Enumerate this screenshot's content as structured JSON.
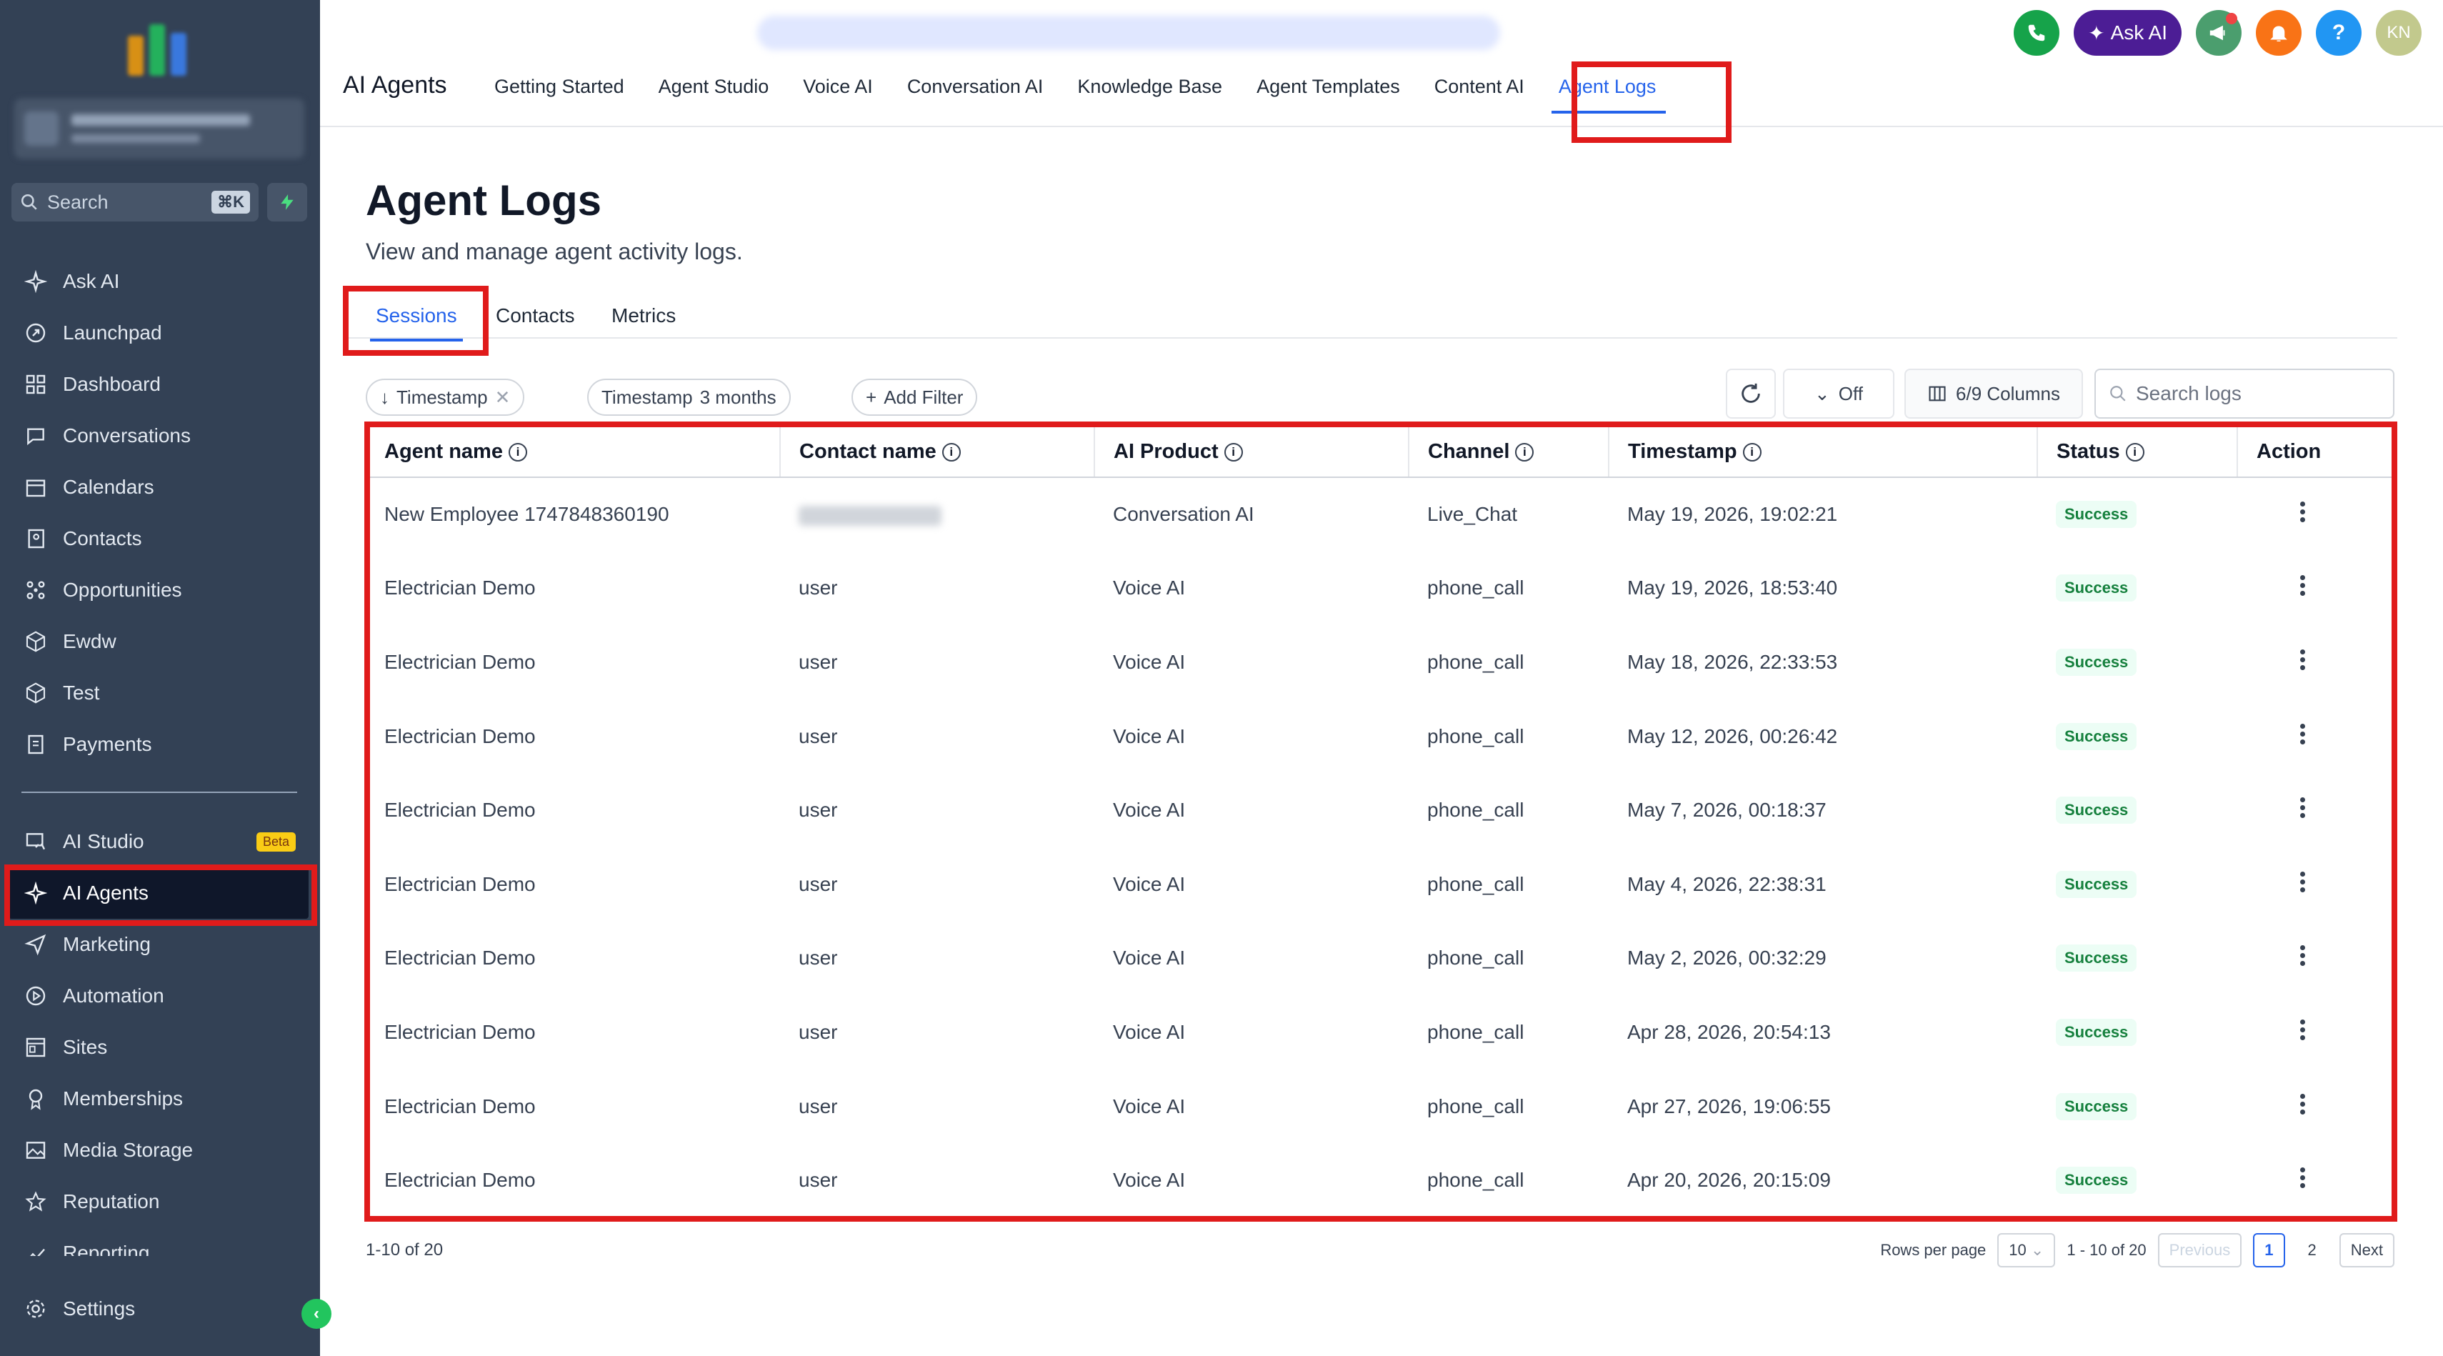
{
  "sidebar": {
    "search_placeholder": "Search",
    "search_shortcut": "⌘K",
    "items": [
      {
        "label": "Ask AI",
        "icon": "sparkle-icon"
      },
      {
        "label": "Launchpad",
        "icon": "rocket-icon"
      },
      {
        "label": "Dashboard",
        "icon": "grid-icon"
      },
      {
        "label": "Conversations",
        "icon": "chat-icon"
      },
      {
        "label": "Calendars",
        "icon": "calendar-icon"
      },
      {
        "label": "Contacts",
        "icon": "contact-book-icon"
      },
      {
        "label": "Opportunities",
        "icon": "pipeline-icon"
      },
      {
        "label": "Ewdw",
        "icon": "cube-icon"
      },
      {
        "label": "Test",
        "icon": "cube-icon"
      },
      {
        "label": "Payments",
        "icon": "receipt-icon"
      }
    ],
    "items2": [
      {
        "label": "AI Studio",
        "icon": "studio-icon",
        "badge": "Beta"
      },
      {
        "label": "AI Agents",
        "icon": "sparkle-icon",
        "active": true
      },
      {
        "label": "Marketing",
        "icon": "send-icon"
      },
      {
        "label": "Automation",
        "icon": "automation-icon"
      },
      {
        "label": "Sites",
        "icon": "sites-icon"
      },
      {
        "label": "Memberships",
        "icon": "membership-icon"
      },
      {
        "label": "Media Storage",
        "icon": "image-icon"
      },
      {
        "label": "Reputation",
        "icon": "star-icon"
      },
      {
        "label": "Reporting",
        "icon": "chart-icon"
      }
    ],
    "settings_label": "Settings"
  },
  "topbar": {
    "app_title": "AI Agents",
    "ask_ai_label": "Ask AI",
    "avatar_initials": "KN",
    "tabs": [
      "Getting Started",
      "Agent Studio",
      "Voice AI",
      "Conversation AI",
      "Knowledge Base",
      "Agent Templates",
      "Content AI",
      "Agent Logs"
    ],
    "active_tab": "Agent Logs"
  },
  "page": {
    "title": "Agent Logs",
    "subtitle": "View and manage agent activity logs.",
    "subtabs": [
      "Sessions",
      "Contacts",
      "Metrics"
    ]
  },
  "toolbar": {
    "sort_chip": "Timestamp",
    "filter_chip_label": "Timestamp",
    "filter_chip_value": "3 months",
    "add_filter": "Add Filter",
    "auto_refresh": "Off",
    "columns": "6/9 Columns",
    "search_placeholder": "Search logs"
  },
  "table": {
    "headers": [
      "Agent name",
      "Contact name",
      "AI Product",
      "Channel",
      "Timestamp",
      "Status",
      "Action"
    ],
    "rows": [
      {
        "agent": "New Employee 1747848360190",
        "contact": "",
        "product": "Conversation AI",
        "channel": "Live_Chat",
        "timestamp": "May 19, 2026, 19:02:21",
        "status": "Success"
      },
      {
        "agent": "Electrician Demo",
        "contact": "user",
        "product": "Voice AI",
        "channel": "phone_call",
        "timestamp": "May 19, 2026, 18:53:40",
        "status": "Success"
      },
      {
        "agent": "Electrician Demo",
        "contact": "user",
        "product": "Voice AI",
        "channel": "phone_call",
        "timestamp": "May 18, 2026, 22:33:53",
        "status": "Success"
      },
      {
        "agent": "Electrician Demo",
        "contact": "user",
        "product": "Voice AI",
        "channel": "phone_call",
        "timestamp": "May 12, 2026, 00:26:42",
        "status": "Success"
      },
      {
        "agent": "Electrician Demo",
        "contact": "user",
        "product": "Voice AI",
        "channel": "phone_call",
        "timestamp": "May 7, 2026, 00:18:37",
        "status": "Success"
      },
      {
        "agent": "Electrician Demo",
        "contact": "user",
        "product": "Voice AI",
        "channel": "phone_call",
        "timestamp": "May 4, 2026, 22:38:31",
        "status": "Success"
      },
      {
        "agent": "Electrician Demo",
        "contact": "user",
        "product": "Voice AI",
        "channel": "phone_call",
        "timestamp": "May 2, 2026, 00:32:29",
        "status": "Success"
      },
      {
        "agent": "Electrician Demo",
        "contact": "user",
        "product": "Voice AI",
        "channel": "phone_call",
        "timestamp": "Apr 28, 2026, 20:54:13",
        "status": "Success"
      },
      {
        "agent": "Electrician Demo",
        "contact": "user",
        "product": "Voice AI",
        "channel": "phone_call",
        "timestamp": "Apr 27, 2026, 19:06:55",
        "status": "Success"
      },
      {
        "agent": "Electrician Demo",
        "contact": "user",
        "product": "Voice AI",
        "channel": "phone_call",
        "timestamp": "Apr 20, 2026, 20:15:09",
        "status": "Success"
      }
    ]
  },
  "footer": {
    "range_left": "1-10 of 20",
    "rows_per_page_label": "Rows per page",
    "rows_per_page_value": "10",
    "range_right": "1 - 10 of 20",
    "previous": "Previous",
    "pages": [
      "1",
      "2"
    ],
    "next": "Next"
  },
  "colors": {
    "sidebar_bg": "#334155",
    "accent": "#2563eb",
    "highlight": "#e01b1b",
    "success": "#15803d"
  }
}
